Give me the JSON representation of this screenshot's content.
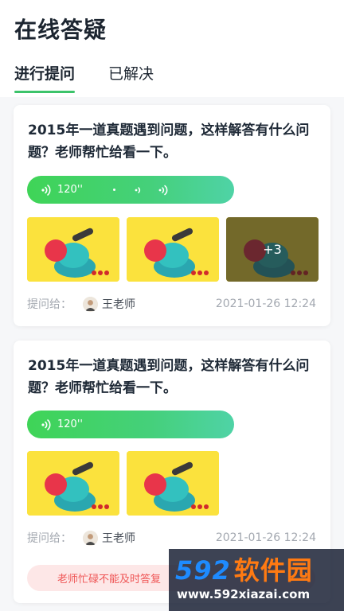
{
  "page_title": "在线答疑",
  "tabs": [
    {
      "label": "进行提问",
      "active": true
    },
    {
      "label": "已解决",
      "active": false
    }
  ],
  "questions": [
    {
      "text": "2015年一道真题遇到问题，这样解答有什么问题？老师帮忙给看一下。",
      "voice_duration": "120''",
      "extra_images": "+3",
      "asked_to_label": "提问给：",
      "teacher": "王老师",
      "time": "2021-01-26 12:24"
    },
    {
      "text": "2015年一道真题遇到问题，这样解答有什么问题？老师帮忙给看一下。",
      "voice_duration": "120''",
      "asked_to_label": "提问给：",
      "teacher": "王老师",
      "time": "2021-01-26 12:24",
      "notice": "老师忙碌不能及时答复"
    }
  ],
  "watermark": {
    "logo_digits": "592",
    "logo_text": "软件园",
    "url": "www.592xiazai.com"
  },
  "colors": {
    "accent_green": "#3cc36a",
    "thumb_yellow": "#fbe23d",
    "notice_red": "#ef5656",
    "notice_bg": "#fde7e7"
  },
  "icons": {
    "voice": "voice-wave-icon",
    "avatar": "teacher-avatar"
  }
}
